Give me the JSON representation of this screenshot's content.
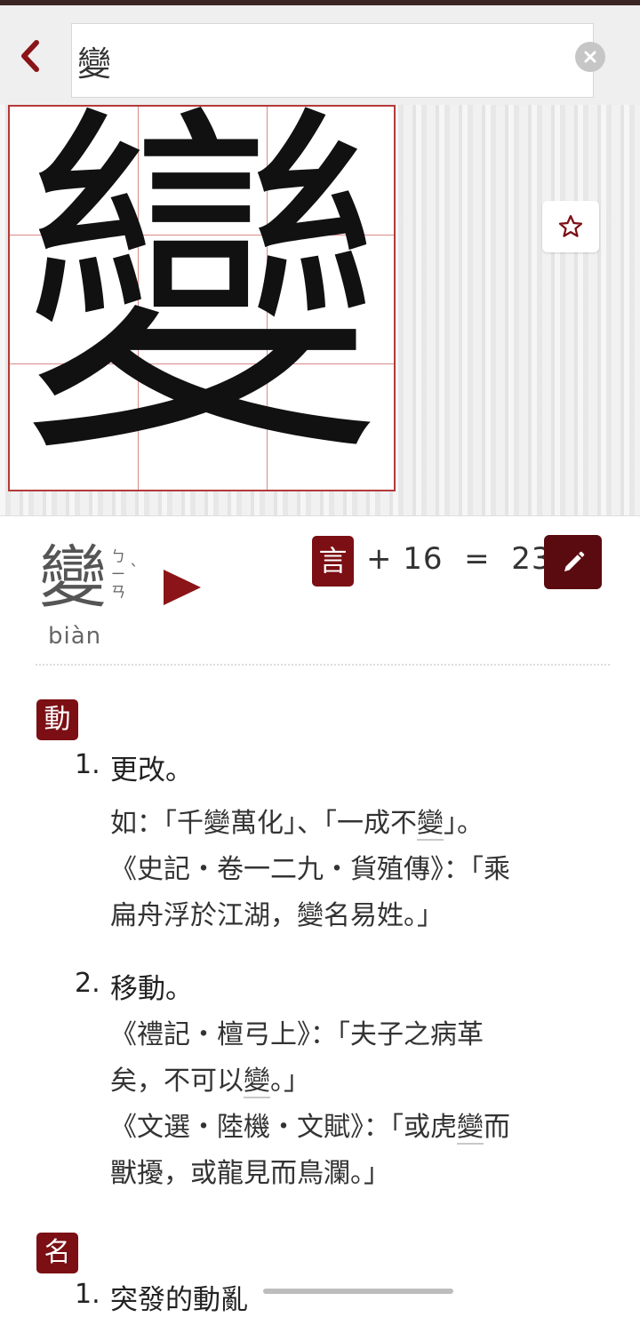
{
  "search": {
    "value": "變"
  },
  "character": {
    "glyph": "變"
  },
  "heading": {
    "char": "變",
    "zhuyin_1": "ㄅ",
    "zhuyin_2": "ㄧ",
    "zhuyin_3": "ㄢ",
    "tone": "ˋ",
    "pinyin": "biàn"
  },
  "radical": {
    "glyph": "言",
    "strokes_text": "+ 16  =  23"
  },
  "colors": {
    "accent": "#7b0f14",
    "accent_dark": "#5a0b10",
    "grid": "#b23a3a"
  },
  "icons": [
    "back-chevron-icon",
    "clear-icon",
    "star-icon",
    "play-icon",
    "pencil-icon"
  ],
  "sections": [
    {
      "pos": "動",
      "senses": [
        {
          "num": "1.",
          "def": "更改。",
          "ex_1a": "如：「千變萬化」、「一成不",
          "ex_1b": "變",
          "ex_1c": "」。",
          "ex_2": "《史記・卷一二九・貨殖傳》：「乘",
          "ex_3": "扁舟浮於江湖，變名易姓。」"
        },
        {
          "num": "2.",
          "def": "移動。",
          "ex_1": "《禮記・檀弓上》：「夫子之病革",
          "ex_2a": "矣，不可以",
          "ex_2b": "變",
          "ex_2c": "。」",
          "ex_3a": "《文選・陸機・文賦》：「或虎",
          "ex_3b": "變",
          "ex_3c": "而",
          "ex_4": "獸擾，或龍見而鳥瀾。」"
        }
      ]
    },
    {
      "pos": "名",
      "senses": [
        {
          "num": "1.",
          "def": "突發的動亂"
        }
      ]
    }
  ]
}
